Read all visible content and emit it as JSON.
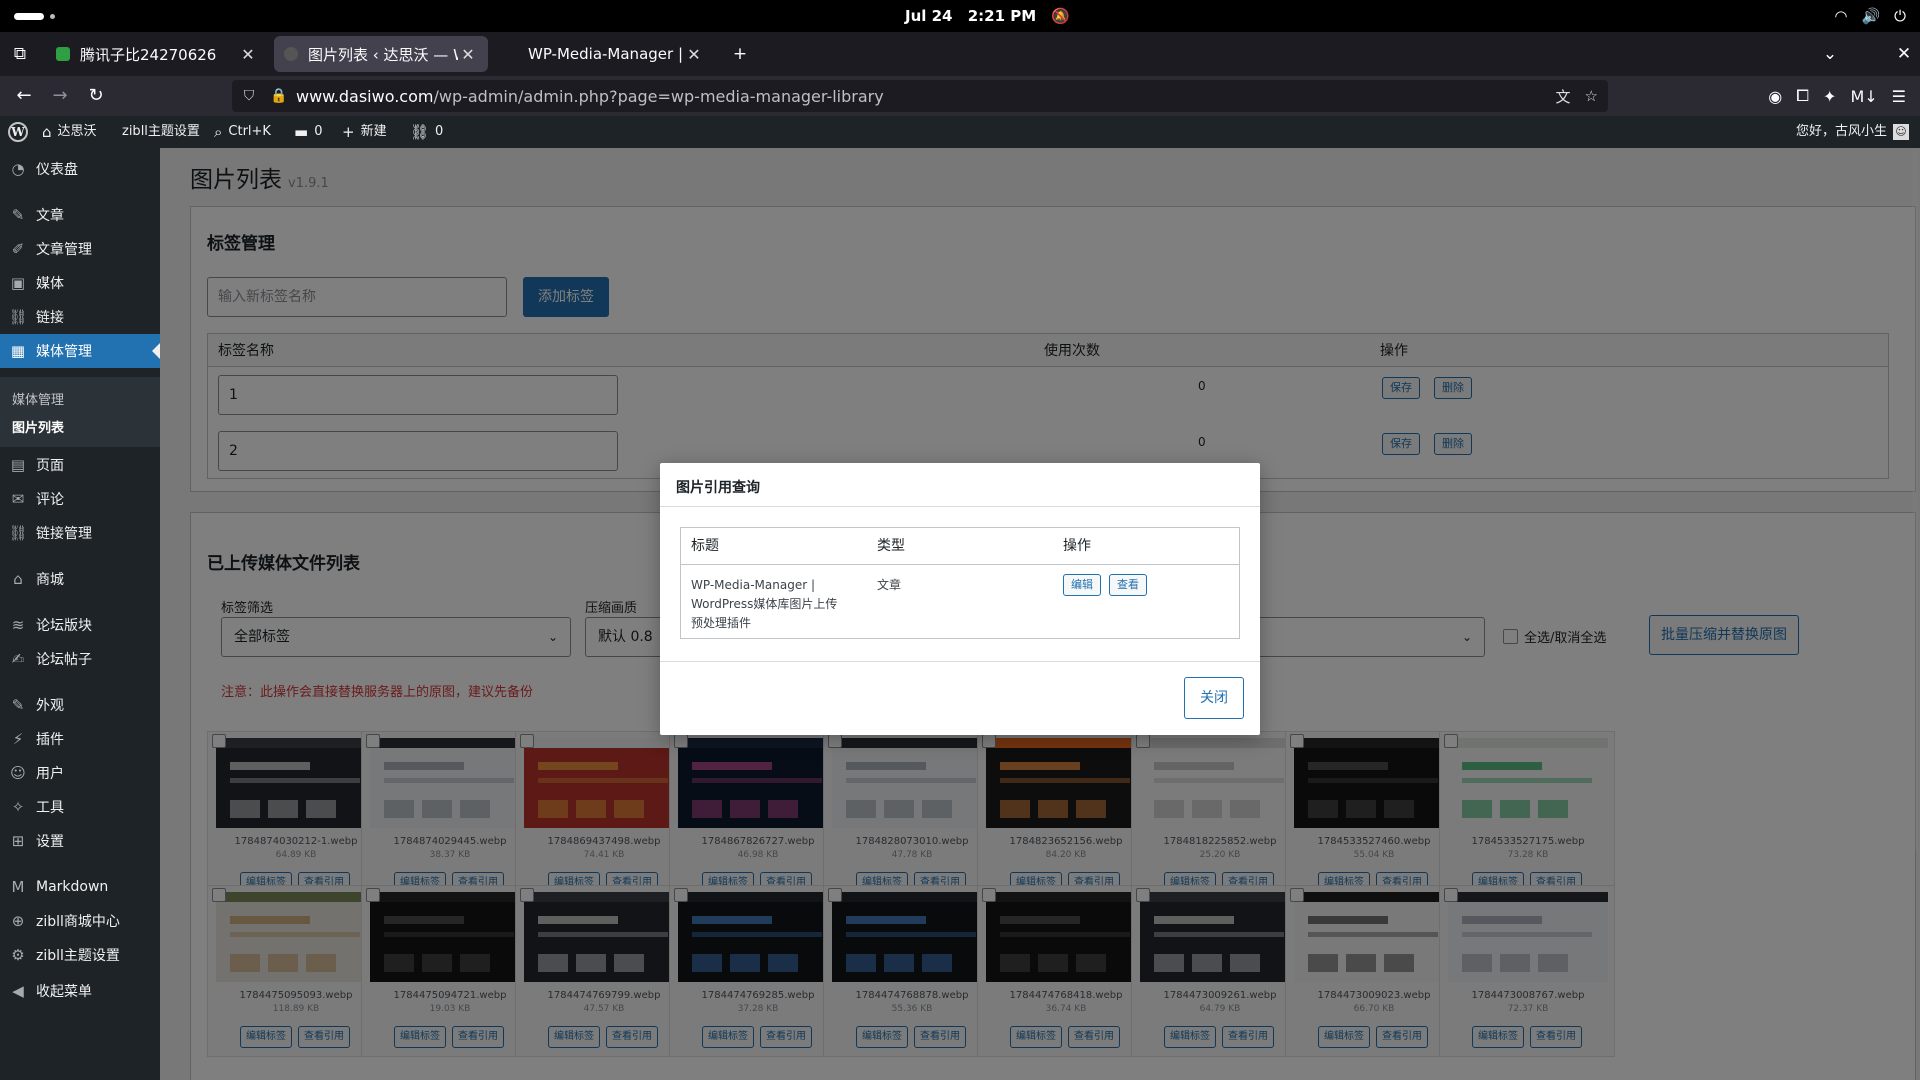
{
  "system": {
    "date": "Jul 24",
    "time": "2:21 PM"
  },
  "browser": {
    "tabs": [
      {
        "title": "腾讯子比24270626",
        "active": false
      },
      {
        "title": "图片列表 ‹ 达思沃 — Wor",
        "active": true
      },
      {
        "title": "WP-Media-Manager | Wo",
        "active": false
      }
    ],
    "url_host": "www.dasiwo.com",
    "url_path": "/wp-admin/admin.php?page=wp-media-manager-library"
  },
  "adminbar": {
    "site_name": "达思沃",
    "theme_settings": "zibll主题设置",
    "search_shortcut": "Ctrl+K",
    "comments_count": "0",
    "new_label": "新建",
    "links_count": "0",
    "greeting": "您好，古风小生"
  },
  "sidebar": {
    "items": [
      {
        "label": "仪表盘",
        "icon": "dashboard-icon",
        "glyph": "◔"
      },
      {
        "label": "文章",
        "icon": "pin-icon",
        "glyph": "✎"
      },
      {
        "label": "文章管理",
        "icon": "edit-icon",
        "glyph": "✐"
      },
      {
        "label": "媒体",
        "icon": "media-icon",
        "glyph": "▣"
      },
      {
        "label": "链接",
        "icon": "link-icon",
        "glyph": "⛓"
      },
      {
        "label": "媒体管理",
        "icon": "image-icon",
        "glyph": "▦"
      },
      {
        "label": "页面",
        "icon": "page-icon",
        "glyph": "▤"
      },
      {
        "label": "评论",
        "icon": "comment-icon",
        "glyph": "✉"
      },
      {
        "label": "链接管理",
        "icon": "link-icon",
        "glyph": "⛓"
      },
      {
        "label": "商城",
        "icon": "store-icon",
        "glyph": "⌂"
      },
      {
        "label": "论坛版块",
        "icon": "forum-icon",
        "glyph": "≋"
      },
      {
        "label": "论坛帖子",
        "icon": "post-icon",
        "glyph": "✍"
      },
      {
        "label": "外观",
        "icon": "brush-icon",
        "glyph": "✎"
      },
      {
        "label": "插件",
        "icon": "plugin-icon",
        "glyph": "⚡"
      },
      {
        "label": "用户",
        "icon": "user-icon",
        "glyph": "☺"
      },
      {
        "label": "工具",
        "icon": "wrench-icon",
        "glyph": "✧"
      },
      {
        "label": "设置",
        "icon": "settings-icon",
        "glyph": "⊞"
      },
      {
        "label": "Markdown",
        "icon": "markdown-icon",
        "glyph": "M"
      },
      {
        "label": "zibll商城中心",
        "icon": "cart-icon",
        "glyph": "⊕"
      },
      {
        "label": "zibll主题设置",
        "icon": "gear-icon",
        "glyph": "⚙"
      },
      {
        "label": "收起菜单",
        "icon": "collapse-icon",
        "glyph": "◀"
      }
    ],
    "submenu": [
      "媒体管理",
      "图片列表"
    ]
  },
  "page": {
    "title": "图片列表",
    "version": "v1.9.1",
    "tags": {
      "heading": "标签管理",
      "input_placeholder": "输入新标签名称",
      "add_button": "添加标签",
      "col_name": "标签名称",
      "col_count": "使用次数",
      "col_action": "操作",
      "rows": [
        {
          "name": "1",
          "count": "0"
        },
        {
          "name": "2",
          "count": "0"
        }
      ],
      "save_label": "保存",
      "delete_label": "删除"
    },
    "media": {
      "heading": "已上传媒体文件列表",
      "filter_label": "标签筛选",
      "filter_value": "全部标签",
      "quality_label": "压缩画质",
      "quality_value": "默认 0.8",
      "select_all": "全选/取消全选",
      "batch_button": "批量压缩并替换原图",
      "warning": "注意：此操作会直接替换服务器上的原图，建议先备份",
      "edit_tag": "编辑标签",
      "view_ref": "查看引用",
      "files": [
        {
          "name": "1784874030212-1.webp",
          "size": "64.89 KB",
          "theme": "dark-ui"
        },
        {
          "name": "1784874029445.webp",
          "size": "38.37 KB",
          "theme": "light-ui"
        },
        {
          "name": "1784869437498.webp",
          "size": "74.41 KB",
          "theme": "red-banner"
        },
        {
          "name": "1784867826727.webp",
          "size": "46.98 KB",
          "theme": "blue-dark"
        },
        {
          "name": "1784828073010.webp",
          "size": "47.78 KB",
          "theme": "light-ui"
        },
        {
          "name": "1784823652156.webp",
          "size": "84.20 KB",
          "theme": "orange"
        },
        {
          "name": "1784818225852.webp",
          "size": "25.20 KB",
          "theme": "white-grid"
        },
        {
          "name": "1784533527460.webp",
          "size": "55.04 KB",
          "theme": "black"
        },
        {
          "name": "1784533527175.webp",
          "size": "73.28 KB",
          "theme": "white-green"
        },
        {
          "name": "1784475095093.webp",
          "size": "118.89 KB",
          "theme": "photo-grid"
        },
        {
          "name": "1784475094721.webp",
          "size": "19.03 KB",
          "theme": "black"
        },
        {
          "name": "1784474769799.webp",
          "size": "47.57 KB",
          "theme": "dark-ui"
        },
        {
          "name": "1784474769285.webp",
          "size": "37.28 KB",
          "theme": "dark-dots"
        },
        {
          "name": "1784474768878.webp",
          "size": "55.36 KB",
          "theme": "dark-dots"
        },
        {
          "name": "1784474768418.webp",
          "size": "36.74 KB",
          "theme": "black"
        },
        {
          "name": "1784473009261.webp",
          "size": "64.79 KB",
          "theme": "dark-ui"
        },
        {
          "name": "1784473009023.webp",
          "size": "66.70 KB",
          "theme": "white-dark"
        },
        {
          "name": "1784473008767.webp",
          "size": "72.37 KB",
          "theme": "light-ui"
        }
      ]
    }
  },
  "modal": {
    "title": "图片引用查询",
    "col_title": "标题",
    "col_type": "类型",
    "col_action": "操作",
    "row": {
      "title_line1": "WP-Media-Manager |",
      "title_line2": "WordPress媒体库图片上传",
      "title_line3": "预处理插件",
      "type": "文章",
      "edit": "编辑",
      "view": "查看"
    },
    "close_button": "关闭"
  },
  "colors": {
    "wp_blue": "#2271b1",
    "admin_dark": "#1d2327",
    "warning_red": "#d63638"
  }
}
